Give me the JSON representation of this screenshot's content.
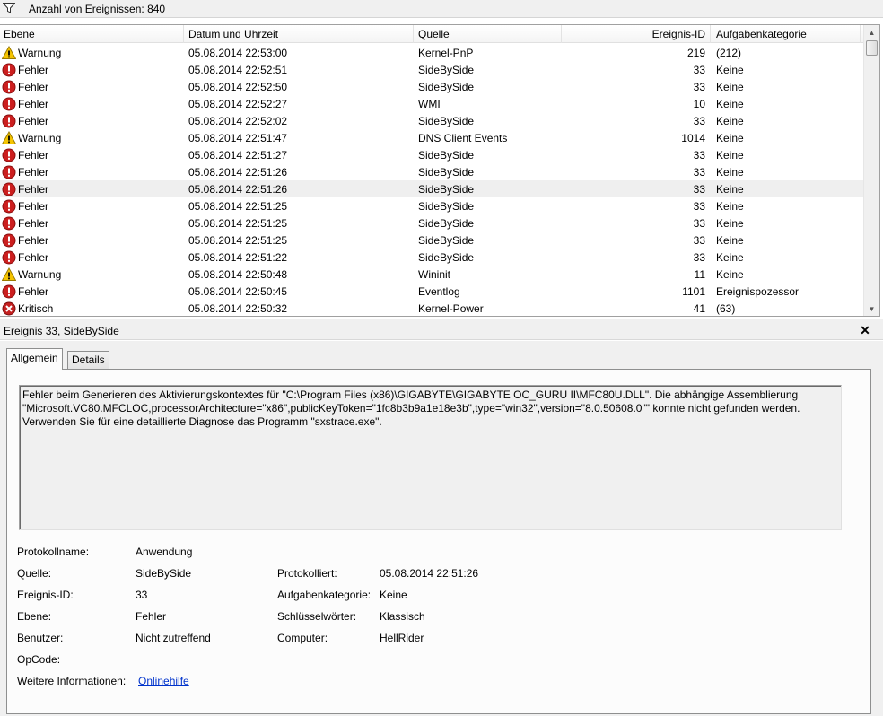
{
  "filter": {
    "icon": "filter-icon",
    "count_text": "Anzahl von Ereignissen: 840"
  },
  "columns": {
    "level": "Ebene",
    "datetime": "Datum und Uhrzeit",
    "source": "Quelle",
    "event_id": "Ereignis-ID",
    "category": "Aufgabenkategorie"
  },
  "events": [
    {
      "level": "Warnung",
      "icon": "warning-icon",
      "datetime": "05.08.2014 22:53:00",
      "source": "Kernel-PnP",
      "id": "219",
      "category": "(212)"
    },
    {
      "level": "Fehler",
      "icon": "error-icon",
      "datetime": "05.08.2014 22:52:51",
      "source": "SideBySide",
      "id": "33",
      "category": "Keine"
    },
    {
      "level": "Fehler",
      "icon": "error-icon",
      "datetime": "05.08.2014 22:52:50",
      "source": "SideBySide",
      "id": "33",
      "category": "Keine"
    },
    {
      "level": "Fehler",
      "icon": "error-icon",
      "datetime": "05.08.2014 22:52:27",
      "source": "WMI",
      "id": "10",
      "category": "Keine"
    },
    {
      "level": "Fehler",
      "icon": "error-icon",
      "datetime": "05.08.2014 22:52:02",
      "source": "SideBySide",
      "id": "33",
      "category": "Keine"
    },
    {
      "level": "Warnung",
      "icon": "warning-icon",
      "datetime": "05.08.2014 22:51:47",
      "source": "DNS Client Events",
      "id": "1014",
      "category": "Keine"
    },
    {
      "level": "Fehler",
      "icon": "error-icon",
      "datetime": "05.08.2014 22:51:27",
      "source": "SideBySide",
      "id": "33",
      "category": "Keine"
    },
    {
      "level": "Fehler",
      "icon": "error-icon",
      "datetime": "05.08.2014 22:51:26",
      "source": "SideBySide",
      "id": "33",
      "category": "Keine"
    },
    {
      "level": "Fehler",
      "icon": "error-icon",
      "datetime": "05.08.2014 22:51:26",
      "source": "SideBySide",
      "id": "33",
      "category": "Keine"
    },
    {
      "level": "Fehler",
      "icon": "error-icon",
      "datetime": "05.08.2014 22:51:25",
      "source": "SideBySide",
      "id": "33",
      "category": "Keine"
    },
    {
      "level": "Fehler",
      "icon": "error-icon",
      "datetime": "05.08.2014 22:51:25",
      "source": "SideBySide",
      "id": "33",
      "category": "Keine"
    },
    {
      "level": "Fehler",
      "icon": "error-icon",
      "datetime": "05.08.2014 22:51:25",
      "source": "SideBySide",
      "id": "33",
      "category": "Keine"
    },
    {
      "level": "Fehler",
      "icon": "error-icon",
      "datetime": "05.08.2014 22:51:22",
      "source": "SideBySide",
      "id": "33",
      "category": "Keine"
    },
    {
      "level": "Warnung",
      "icon": "warning-icon",
      "datetime": "05.08.2014 22:50:48",
      "source": "Wininit",
      "id": "11",
      "category": "Keine"
    },
    {
      "level": "Fehler",
      "icon": "error-icon",
      "datetime": "05.08.2014 22:50:45",
      "source": "Eventlog",
      "id": "1101",
      "category": "Ereignispozessor"
    },
    {
      "level": "Kritisch",
      "icon": "critical-icon",
      "datetime": "05.08.2014 22:50:32",
      "source": "Kernel-Power",
      "id": "41",
      "category": "(63)"
    }
  ],
  "detail": {
    "title": "Ereignis 33, SideBySide",
    "close_label": "✕",
    "tabs": [
      "Allgemein",
      "Details"
    ],
    "message": "Fehler beim Generieren des Aktivierungskontextes für \"C:\\Program Files (x86)\\GIGABYTE\\GIGABYTE OC_GURU II\\MFC80U.DLL\". Die abhängige Assemblierung \"Microsoft.VC80.MFCLOC,processorArchitecture=\"x86\",publicKeyToken=\"1fc8b3b9a1e18e3b\",type=\"win32\",version=\"8.0.50608.0\"\" konnte nicht gefunden werden.\nVerwenden Sie für eine detaillierte Diagnose das Programm \"sxstrace.exe\".",
    "props": {
      "protokollname_label": "Protokollname:",
      "protokollname_value": "Anwendung",
      "quelle_label": "Quelle:",
      "quelle_value": "SideBySide",
      "protokolliert_label": "Protokolliert:",
      "protokolliert_value": "05.08.2014 22:51:26",
      "ereignis_id_label": "Ereignis-ID:",
      "ereignis_id_value": "33",
      "aufgabenkategorie_label": "Aufgabenkategorie:",
      "aufgabenkategorie_value": "Keine",
      "ebene_label": "Ebene:",
      "ebene_value": "Fehler",
      "schluesselwoerter_label": "Schlüsselwörter:",
      "schluesselwoerter_value": "Klassisch",
      "benutzer_label": "Benutzer:",
      "benutzer_value": "Nicht zutreffend",
      "computer_label": "Computer:",
      "computer_value": "HellRider",
      "opcode_label": "OpCode:",
      "weitere_label": "Weitere Informationen:",
      "weitere_link": "Onlinehilfe"
    }
  },
  "colors": {
    "error": "#cc1f1f",
    "critical": "#c42020",
    "warning": "#f5c400",
    "link": "#0033cc"
  }
}
